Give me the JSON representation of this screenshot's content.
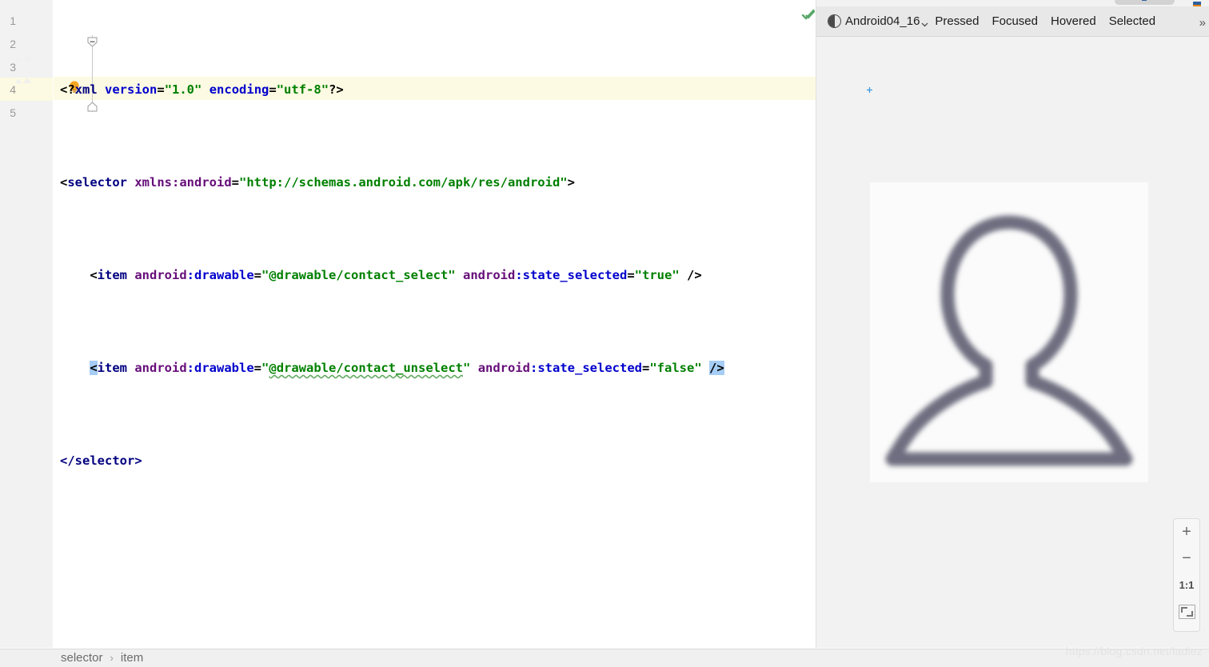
{
  "editor": {
    "lines": [
      {
        "number": "1",
        "gutter_icon": null,
        "text": "<?xml version=\"1.0\" encoding=\"utf-8\"?>"
      },
      {
        "number": "2",
        "gutter_icon": null,
        "text": "<selector xmlns:android=\"http://schemas.android.com/apk/res/android\">"
      },
      {
        "number": "3",
        "gutter_icon": "image-preview-icon",
        "text": "    <item android:drawable=\"@drawable/contact_select\" android:state_selected=\"true\" />"
      },
      {
        "number": "4",
        "gutter_icon": "image-preview-icon",
        "text": "    <item android:drawable=\"@drawable/contact_unselect\" android:state_selected=\"false\" />"
      },
      {
        "number": "5",
        "gutter_icon": null,
        "text": "</selector>"
      }
    ],
    "tokens": {
      "l1": {
        "open": "<?",
        "proc": "xml",
        "space1": " ",
        "attr1": "version",
        "eq1": "=",
        "val1": "\"1.0\"",
        "space2": " ",
        "attr2": "encoding",
        "eq2": "=",
        "val2": "\"utf-8\"",
        "close": "?>"
      },
      "l2": {
        "lt": "<",
        "tag": "selector",
        "space": " ",
        "attr": "xmlns:android",
        "eq": "=",
        "val": "\"http://schemas.android.com/apk/res/android\"",
        "gt": ">"
      },
      "l3": {
        "indent": "    ",
        "lt": "<",
        "tag": "item",
        "space1": " ",
        "ns1": "android",
        "attr1": ":drawable",
        "eq1": "=",
        "val1": "\"@drawable/contact_select\"",
        "space2": " ",
        "ns2": "android",
        "attr2": ":state_selected",
        "eq2": "=",
        "val2": "\"true\"",
        "space3": " ",
        "selfclose": "/>"
      },
      "l4": {
        "indent": "    ",
        "lt": "<",
        "tag": "item",
        "space1": " ",
        "ns1": "android",
        "attr1": ":drawable",
        "eq1": "=",
        "quote_open": "\"",
        "val1": "@drawable/contact_unselect",
        "quote_close": "\"",
        "space2": " ",
        "ns2": "android",
        "attr2": ":state_selected",
        "eq2": "=",
        "val2": "\"false\"",
        "space3": " ",
        "selfclose": "/>"
      },
      "l5": {
        "closetag": "</selector>"
      }
    },
    "inspection_status": "ok",
    "intention_bulb": "lightbulb-icon"
  },
  "preview": {
    "toolbar": {
      "config_icon": "theme-contrast-icon",
      "config_name": "Android04_16",
      "dropdown_icon": "chevron-down-icon",
      "states": [
        "Pressed",
        "Focused",
        "Hovered",
        "Selected"
      ],
      "overflow": "»"
    },
    "render": {
      "image_name": "contact-person-icon"
    },
    "zoom_controls": {
      "zoom_in": "+",
      "zoom_out": "−",
      "actual_size": "1:1",
      "fit_to_screen": "fit-screen-icon"
    }
  },
  "status_bar": {
    "breadcrumb": [
      "selector",
      "item"
    ],
    "separator": "›",
    "watermark": "https://blog.csdn.net/ladiez"
  },
  "colors": {
    "tag": "#000080",
    "attribute": "#660e7a",
    "namespace": "#0000cd",
    "value": "#008000",
    "selection": "#a5cdf5",
    "current_line": "#fcfae2",
    "gutter_bg": "#f2f2f2",
    "panel_bg": "#f2f2f2",
    "toolbar_bg": "#e8e8e8"
  }
}
